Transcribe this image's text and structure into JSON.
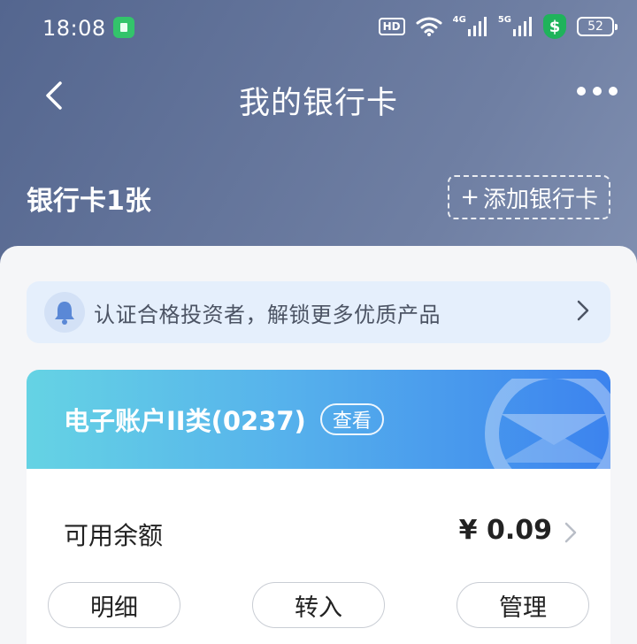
{
  "status_bar": {
    "time": "18:08",
    "hd_label": "HD",
    "signal_1_label": "4G",
    "signal_2_label": "5G",
    "shield_symbol": "$",
    "battery": "52"
  },
  "nav": {
    "title": "我的银行卡"
  },
  "cards_header": {
    "count_label": "银行卡1张",
    "add_plus": "+",
    "add_label": "添加银行卡"
  },
  "notice": {
    "text": "认证合格投资者，解锁更多优质产品"
  },
  "account": {
    "name": "电子账户II类(0237)",
    "view_label": "查看",
    "balance_label": "可用余额",
    "balance_value": "¥ 0.09"
  },
  "actions": [
    {
      "label": "明细"
    },
    {
      "label": "转入"
    },
    {
      "label": "管理"
    }
  ],
  "colors": {
    "header_gradient_start": "#54668f",
    "card_gradient_start": "#65d3e4",
    "card_gradient_end": "#3c83ee",
    "notice_bg": "#e5effc",
    "shield_green": "#1fb35b"
  }
}
